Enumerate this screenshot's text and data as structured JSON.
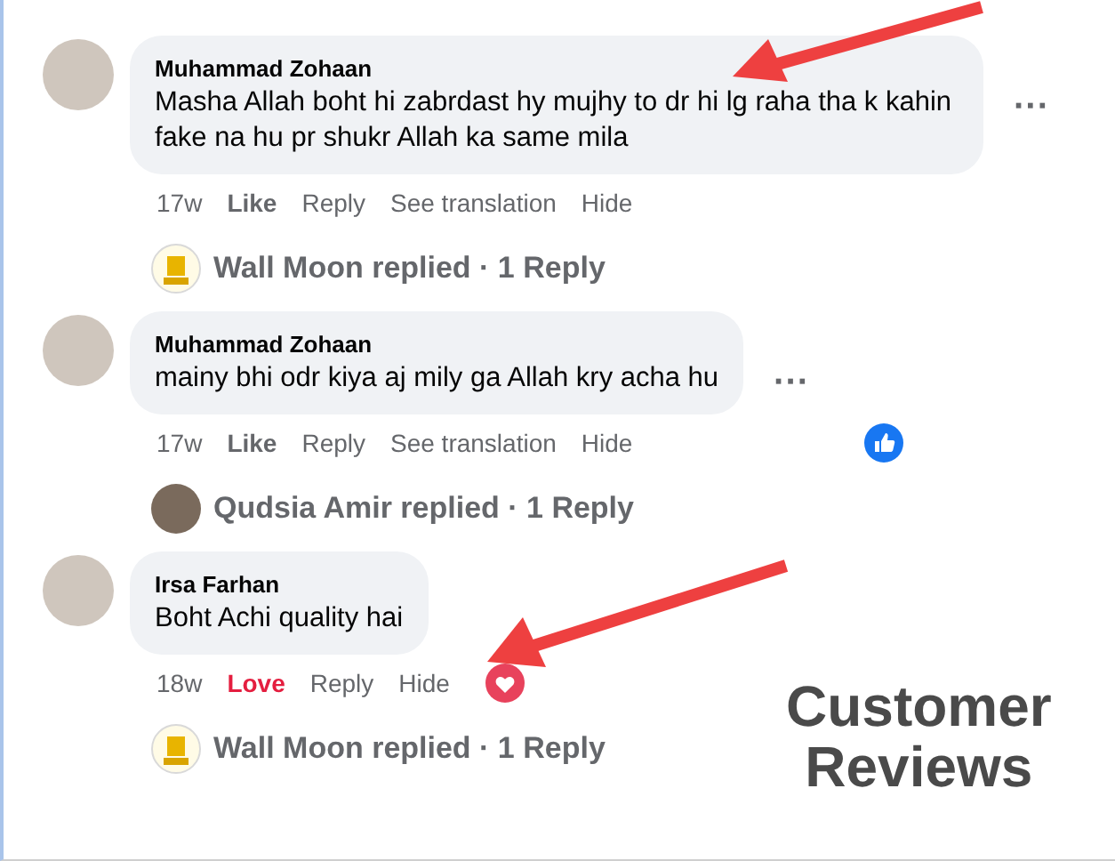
{
  "comments": [
    {
      "author": "Muhammad Zohaan",
      "text": "Masha Allah boht hi zabrdast hy mujhy to dr hi lg raha tha k kahin fake na hu pr shukr Allah ka same mila",
      "time": "17w",
      "reaction": {
        "label": "Like",
        "kind": "none"
      },
      "actions": [
        "Reply",
        "See translation",
        "Hide"
      ],
      "more": "···",
      "replies": {
        "kind": "logo",
        "text": "Wall Moon replied · 1 Reply"
      }
    },
    {
      "author": "Muhammad Zohaan",
      "text": "mainy bhi odr kiya aj mily ga Allah kry acha hu",
      "time": "17w",
      "reaction": {
        "label": "Like",
        "kind": "none"
      },
      "actions": [
        "Reply",
        "See translation",
        "Hide"
      ],
      "badge": {
        "kind": "like"
      },
      "more": "···",
      "replies": {
        "kind": "photo",
        "text": "Qudsia Amir replied · 1 Reply"
      }
    },
    {
      "author": "Irsa Farhan",
      "text": "Boht Achi quality hai",
      "time": "18w",
      "reaction": {
        "label": "Love",
        "kind": "love"
      },
      "actions": [
        "Reply",
        "Hide"
      ],
      "badge": {
        "kind": "love"
      },
      "replies": {
        "kind": "logo",
        "text": "Wall Moon replied · 1 Reply"
      }
    }
  ],
  "caption": [
    "Customer",
    "Reviews"
  ]
}
